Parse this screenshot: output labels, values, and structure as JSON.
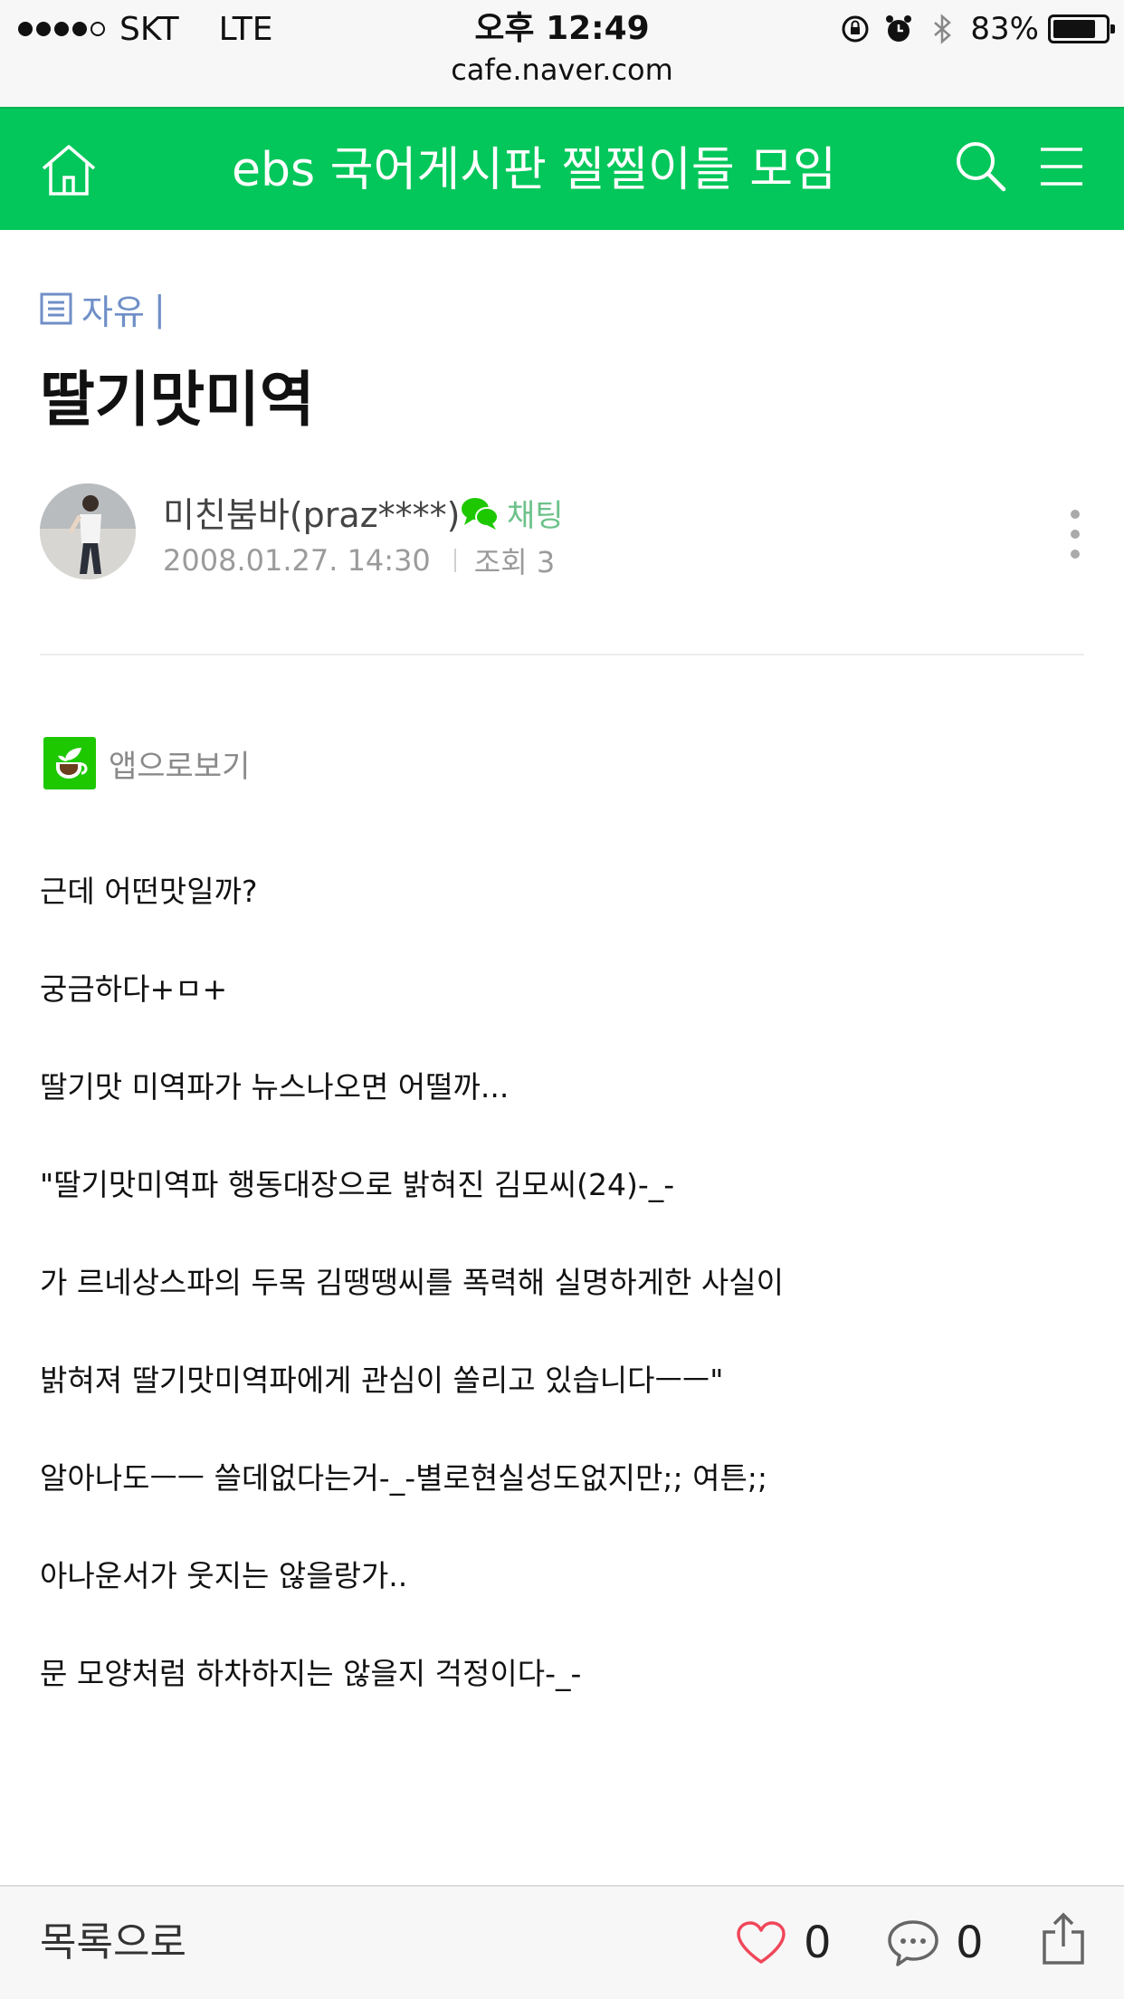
{
  "status_bar": {
    "carrier": "SKT",
    "network": "LTE",
    "time": "오후 12:49",
    "battery_percent": "83%",
    "battery_level": 0.83
  },
  "browser": {
    "url": "cafe.naver.com"
  },
  "header": {
    "title": "ebs 국어게시판 찔찔이들 모임",
    "icons": [
      "home-icon",
      "search-icon",
      "menu-icon"
    ],
    "background_color": "#03c75a"
  },
  "post": {
    "category": "자유",
    "category_separator": "|",
    "title": "딸기맛미역",
    "author": "미친붐바(praz****)",
    "chat_label": "채팅",
    "date": "2008.01.27. 14:30",
    "views": "조회 3",
    "app_view_label": "앱으로보기",
    "body": [
      "근데 어떤맛일까?",
      "궁금하다+ㅁ+",
      "딸기맛 미역파가 뉴스나오면 어떨까...",
      "\"딸기맛미역파 행동대장으로 밝혀진 김모씨(24)-_-",
      "가  르네상스파의 두목 김땡땡씨를 폭력해 실명하게한 사실이",
      "밝혀져 딸기맛미역파에게 관심이 쏠리고 있습니다ㅡㅡ\"",
      "알아나도ㅡㅡ 쓸데없다는거-_-별로현실성도없지만;; 여튼;;",
      "아나운서가 웃지는 않을랑가..",
      "문 모양처럼 하차하지는 않을지 걱정이다-_-"
    ]
  },
  "bottom_bar": {
    "back_label": "목록으로",
    "likes": "0",
    "comments": "0"
  }
}
